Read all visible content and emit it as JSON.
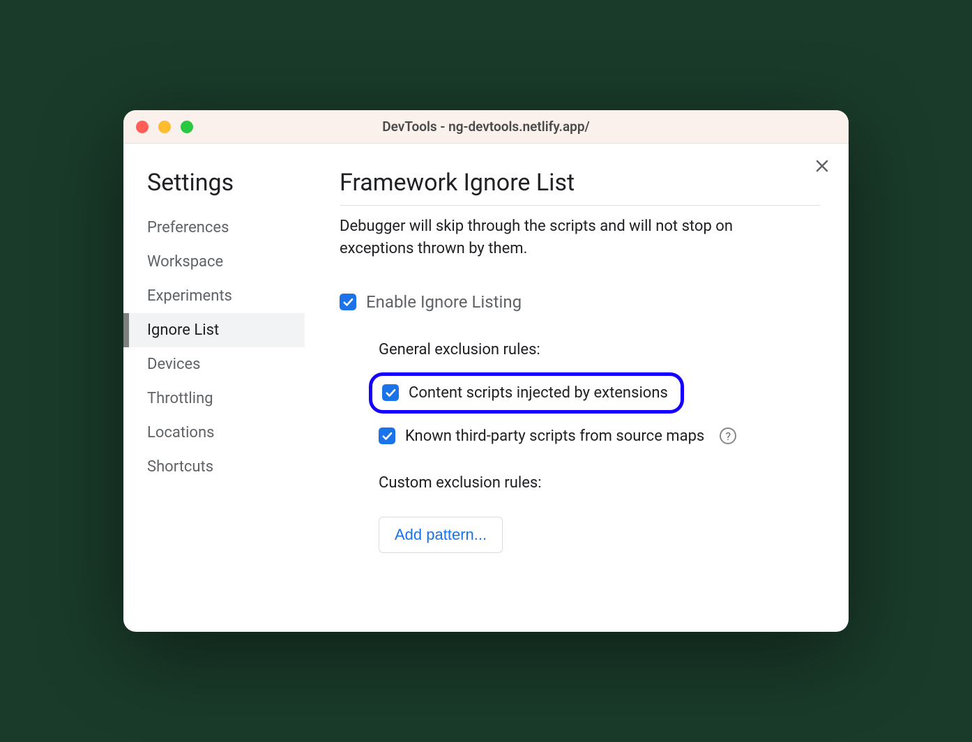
{
  "window": {
    "title": "DevTools - ng-devtools.netlify.app/"
  },
  "sidebar": {
    "title": "Settings",
    "items": [
      {
        "label": "Preferences",
        "active": false
      },
      {
        "label": "Workspace",
        "active": false
      },
      {
        "label": "Experiments",
        "active": false
      },
      {
        "label": "Ignore List",
        "active": true
      },
      {
        "label": "Devices",
        "active": false
      },
      {
        "label": "Throttling",
        "active": false
      },
      {
        "label": "Locations",
        "active": false
      },
      {
        "label": "Shortcuts",
        "active": false
      }
    ]
  },
  "panel": {
    "title": "Framework Ignore List",
    "description": "Debugger will skip through the scripts and will not stop on exceptions thrown by them.",
    "enable_label": "Enable Ignore Listing",
    "enable_checked": true,
    "general_rules_label": "General exclusion rules:",
    "rule1": {
      "label": "Content scripts injected by extensions",
      "checked": true,
      "highlighted": true
    },
    "rule2": {
      "label": "Known third-party scripts from source maps",
      "checked": true,
      "help": true
    },
    "custom_rules_label": "Custom exclusion rules:",
    "add_pattern_label": "Add pattern..."
  },
  "colors": {
    "accent": "#1a73e8",
    "highlight": "#1500ff"
  }
}
